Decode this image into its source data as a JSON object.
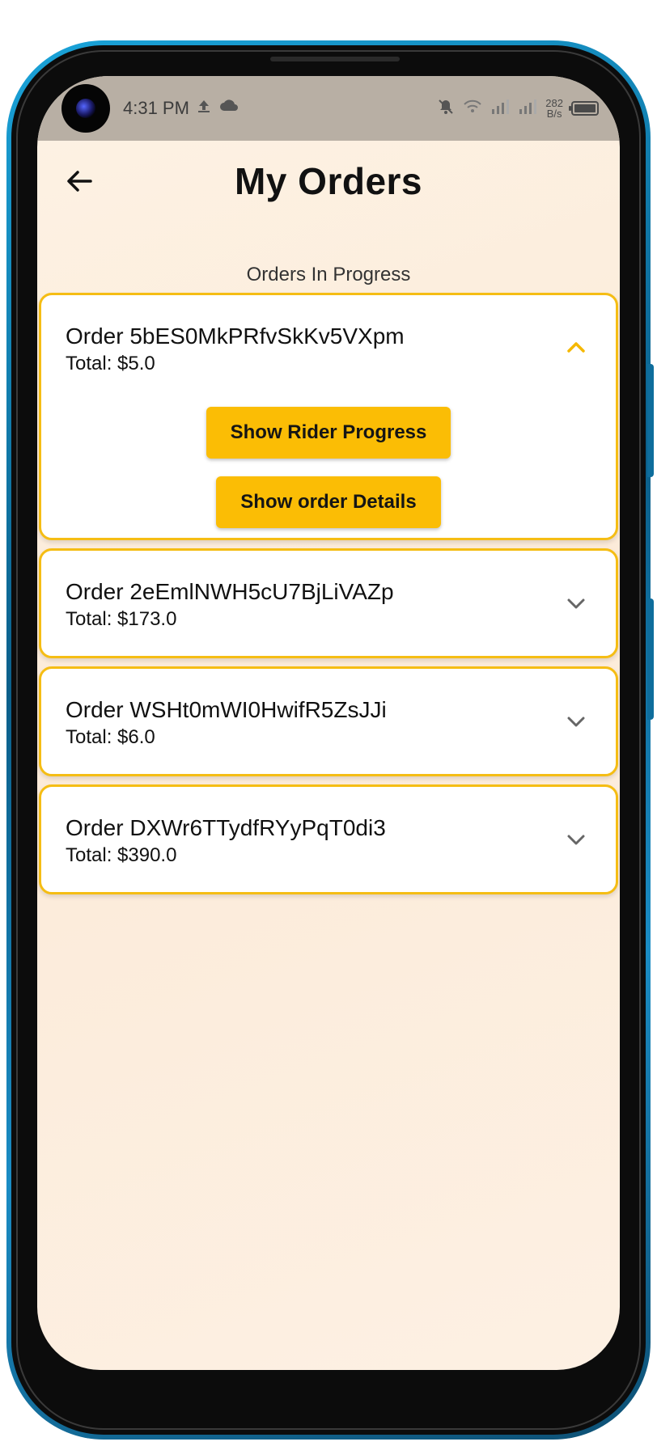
{
  "status_bar": {
    "time": "4:31 PM",
    "net_speed_value": "282",
    "net_speed_unit": "B/s",
    "icons": [
      "upload-icon",
      "cloud-icon",
      "mute-icon",
      "wifi-icon",
      "signal-icon",
      "signal-icon",
      "battery-icon"
    ]
  },
  "header": {
    "title": "My Orders"
  },
  "section": {
    "label": "Orders In Progress"
  },
  "orders": [
    {
      "id_label": "Order 5bES0MkPRfvSkKv5VXpm",
      "total_label": "Total: $5.0",
      "expanded": true,
      "actions": {
        "rider_progress": "Show Rider Progress",
        "order_details": "Show order Details"
      }
    },
    {
      "id_label": "Order 2eEmlNWH5cU7BjLiVAZp",
      "total_label": "Total: $173.0",
      "expanded": false
    },
    {
      "id_label": "Order WSHt0mWI0HwifR5ZsJJi",
      "total_label": "Total: $6.0",
      "expanded": false
    },
    {
      "id_label": "Order DXWr6TTydfRYyPqT0di3",
      "total_label": "Total: $390.0",
      "expanded": false
    }
  ],
  "colors": {
    "accent": "#fbbd05",
    "card_border": "#f5bd14",
    "background": "#fdf0e3",
    "status_bar": "#b8afa4",
    "phone_frame": "#1aa3d9"
  }
}
